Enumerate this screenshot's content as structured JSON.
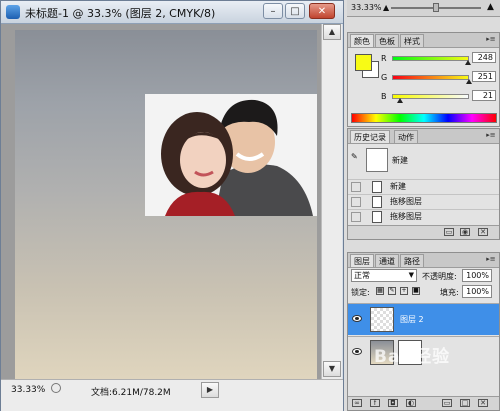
{
  "window": {
    "title": "未标题-1 @ 33.3% (图层 2, CMYK/8)",
    "min_label": "–",
    "max_label": "□",
    "close_label": "✕"
  },
  "status": {
    "zoom": "33.33%",
    "doc_size": "文档:6.21M/78.2M"
  },
  "navigator": {
    "zoom": "33.33%"
  },
  "color_panel": {
    "tabs": [
      "颜色",
      "色板",
      "样式"
    ],
    "channels": [
      {
        "label": "R",
        "value": "248"
      },
      {
        "label": "G",
        "value": "251"
      },
      {
        "label": "B",
        "value": "21"
      }
    ],
    "foreground_color": "#f8fb15",
    "background_color": "#ffffff"
  },
  "history_panel": {
    "tabs": [
      "历史记录",
      "动作"
    ],
    "snapshot_label": "新建",
    "items": [
      "新建",
      "拖移图层",
      "拖移图层"
    ]
  },
  "layers_panel": {
    "tabs": [
      "图层",
      "通道",
      "路径"
    ],
    "blend_mode": "正常",
    "opacity_label": "不透明度:",
    "opacity_value": "100%",
    "lock_label": "锁定:",
    "fill_label": "填充:",
    "fill_value": "100%",
    "layers": [
      {
        "name": "图层 2",
        "selected": true
      },
      {
        "name": "",
        "selected": false
      }
    ]
  },
  "watermark": "Bai 经验"
}
